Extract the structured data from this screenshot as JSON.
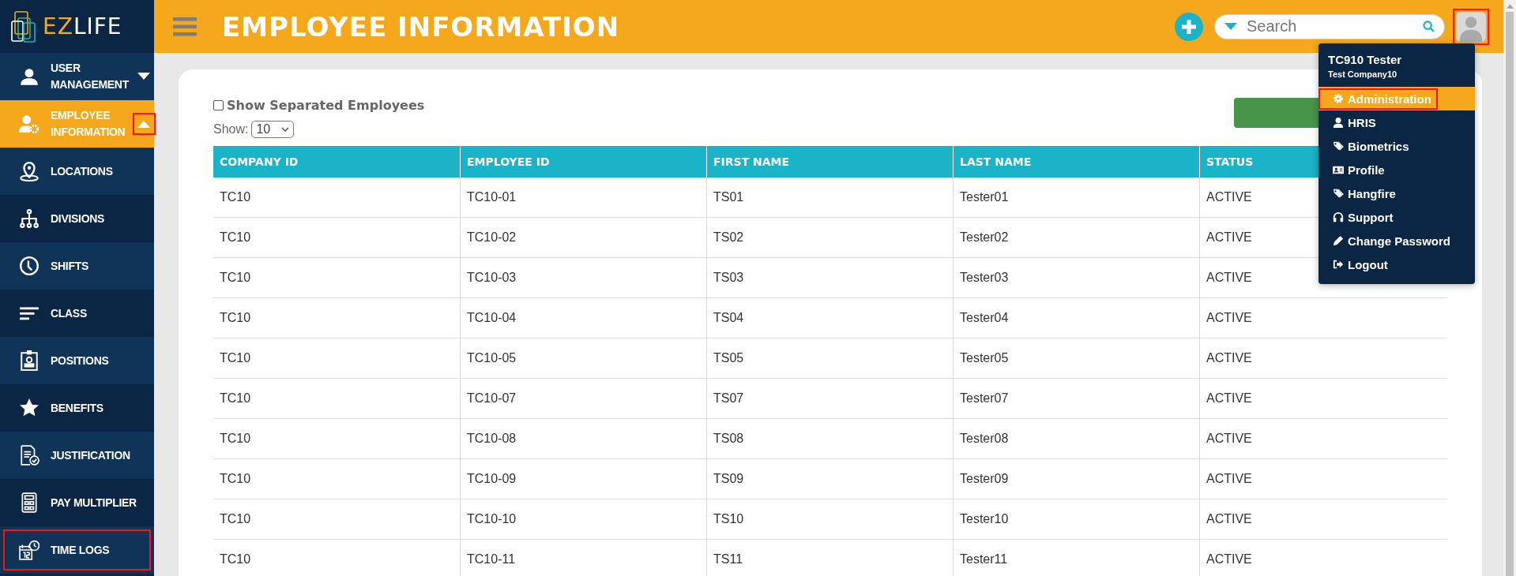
{
  "sidebar": {
    "logo": {
      "part_1": "EZ",
      "part_2": "LIFE"
    },
    "groups": [
      {
        "label": "USER MANAGEMENT",
        "kind": "user",
        "selected": false,
        "expanded": false,
        "highlighted": false
      },
      {
        "label": "EMPLOYEE INFORMATION",
        "kind": "user-gear",
        "selected": true,
        "expanded": true,
        "highlighted": true
      }
    ],
    "items": [
      {
        "label": "LOCATIONS",
        "kind": "pin",
        "highlighted": false
      },
      {
        "label": "DIVISIONS",
        "kind": "tree",
        "highlighted": false
      },
      {
        "label": "SHIFTS",
        "kind": "clock",
        "highlighted": false
      },
      {
        "label": "CLASS",
        "kind": "lines",
        "highlighted": false
      },
      {
        "label": "POSITIONS",
        "kind": "badge",
        "highlighted": false
      },
      {
        "label": "BENEFITS",
        "kind": "star",
        "highlighted": false
      },
      {
        "label": "JUSTIFICATION",
        "kind": "doc",
        "highlighted": false
      },
      {
        "label": "PAY MULTIPLIER",
        "kind": "calc",
        "highlighted": false
      },
      {
        "label": "TIME LOGS",
        "kind": "calendar",
        "highlighted": true
      }
    ]
  },
  "header": {
    "title": "EMPLOYEE INFORMATION",
    "search": {
      "placeholder": "Search"
    },
    "avatar": {
      "highlighted": true
    }
  },
  "user_menu": {
    "name": "TC910 Tester",
    "company": "Test Company10",
    "items": [
      {
        "label": "Administration",
        "kind": "gear",
        "selected": true,
        "highlighted": true
      },
      {
        "label": "HRIS",
        "kind": "person",
        "selected": false,
        "highlighted": false
      },
      {
        "label": "Biometrics",
        "kind": "tags",
        "selected": false,
        "highlighted": false
      },
      {
        "label": "Profile",
        "kind": "card",
        "selected": false,
        "highlighted": false
      },
      {
        "label": "Hangfire",
        "kind": "tags",
        "selected": false,
        "highlighted": false
      },
      {
        "label": "Support",
        "kind": "headset",
        "selected": false,
        "highlighted": false
      },
      {
        "label": "Change Password",
        "kind": "pencil",
        "selected": false,
        "highlighted": false
      },
      {
        "label": "Logout",
        "kind": "logout",
        "selected": false,
        "highlighted": false
      }
    ]
  },
  "filters": {
    "show_separated": {
      "label": "Show Separated Employees",
      "checked": false
    },
    "page_size": {
      "label": "Show:",
      "value": "10"
    }
  },
  "table": {
    "columns": [
      "COMPANY ID",
      "EMPLOYEE ID",
      "FIRST NAME",
      "LAST NAME",
      "STATUS"
    ],
    "rows": [
      [
        "TC10",
        "TC10-01",
        "TS01",
        "Tester01",
        "ACTIVE"
      ],
      [
        "TC10",
        "TC10-02",
        "TS02",
        "Tester02",
        "ACTIVE"
      ],
      [
        "TC10",
        "TC10-03",
        "TS03",
        "Tester03",
        "ACTIVE"
      ],
      [
        "TC10",
        "TC10-04",
        "TS04",
        "Tester04",
        "ACTIVE"
      ],
      [
        "TC10",
        "TC10-05",
        "TS05",
        "Tester05",
        "ACTIVE"
      ],
      [
        "TC10",
        "TC10-07",
        "TS07",
        "Tester07",
        "ACTIVE"
      ],
      [
        "TC10",
        "TC10-08",
        "TS08",
        "Tester08",
        "ACTIVE"
      ],
      [
        "TC10",
        "TC10-09",
        "TS09",
        "Tester09",
        "ACTIVE"
      ],
      [
        "TC10",
        "TC10-10",
        "TS10",
        "Tester10",
        "ACTIVE"
      ],
      [
        "TC10",
        "TC10-11",
        "TS11",
        "Tester11",
        "ACTIVE"
      ]
    ]
  }
}
